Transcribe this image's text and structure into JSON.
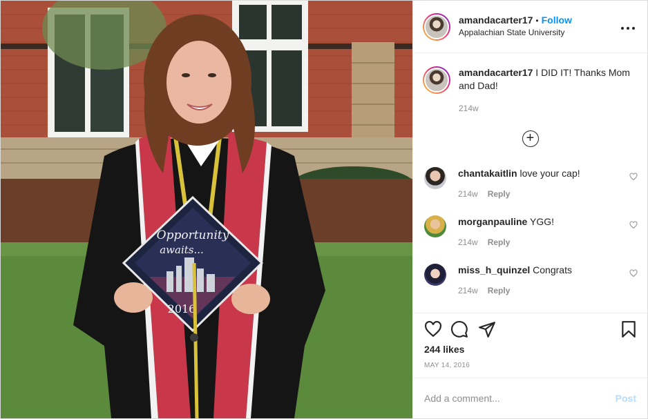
{
  "header": {
    "username": "amandacarter17",
    "separator": "•",
    "follow_label": "Follow",
    "location": "Appalachian State University",
    "more_icon": "more-horizontal-icon"
  },
  "caption": {
    "username": "amandacarter17",
    "text": "I DID IT! Thanks Mom and Dad!",
    "timestamp": "214w"
  },
  "load_more_icon": "plus-circle-icon",
  "comments": [
    {
      "username": "chantakaitlin",
      "text": "love your cap!",
      "timestamp": "214w",
      "reply_label": "Reply"
    },
    {
      "username": "morganpauline",
      "text": "YGG!",
      "timestamp": "214w",
      "reply_label": "Reply"
    },
    {
      "username": "miss_h_quinzel",
      "text": "Congrats",
      "timestamp": "214w",
      "reply_label": "Reply"
    }
  ],
  "actions": {
    "icons": [
      "heart-icon",
      "comment-icon",
      "share-icon",
      "bookmark-icon"
    ],
    "likes": "244 likes",
    "date": "MAY 14, 2016"
  },
  "add_comment": {
    "placeholder": "Add a comment...",
    "post_label": "Post"
  },
  "photo": {
    "cap_text_line1": "Opportunity",
    "cap_text_line2": "awaits...",
    "cap_year": "2016"
  }
}
